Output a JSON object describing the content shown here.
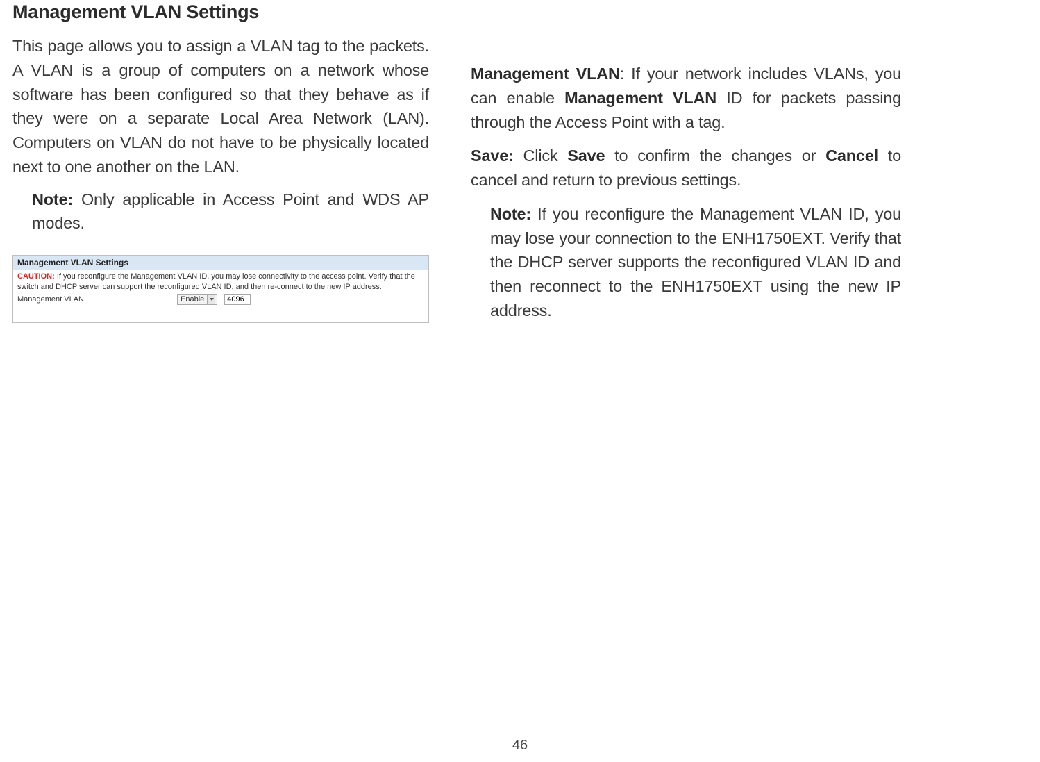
{
  "title": "Management VLAN Settings",
  "left": {
    "p1": "This page allows you to assign a VLAN tag to the packets. A VLAN is a group of computers on a network whose software has been configured so that they behave as if they were on a separate Local Area Network (LAN). Computers on VLAN do not have to be physically located next to one another on the LAN.",
    "note_label": "Note:",
    "note_text": " Only applicable in Access Point and WDS AP modes."
  },
  "panel": {
    "header": "Management VLAN Settings",
    "caution_label": "CAUTION:",
    "caution_text": " If you reconfigure the Management VLAN ID, you may lose connectivity to the access point. Verify that the switch and DHCP server can support the reconfigured VLAN ID, and then re-connect to the new IP address.",
    "row_label": "Management VLAN",
    "select_value": "Enable",
    "input_value": "4096"
  },
  "right": {
    "mv_label": "Management VLAN",
    "mv_text_a": ": If your network includes VLANs, you can enable ",
    "mv_bold_mid": "Management VLAN",
    "mv_text_b": " ID for packets passing through the Access Point with a tag.",
    "save_label": "Save:",
    "save_text_a": " Click ",
    "save_bold_save": "Save",
    "save_text_b": " to confirm the changes or ",
    "save_bold_cancel": "Cancel",
    "save_text_c": " to cancel and return to previous settings.",
    "note_label": "Note:",
    "note_text": " If you reconfigure the Management VLAN ID, you may lose your connection to the ENH1750EXT. Verify that the DHCP server supports the reconfigured VLAN ID and then reconnect to the ENH1750EXT using the new IP address."
  },
  "page_number": "46"
}
